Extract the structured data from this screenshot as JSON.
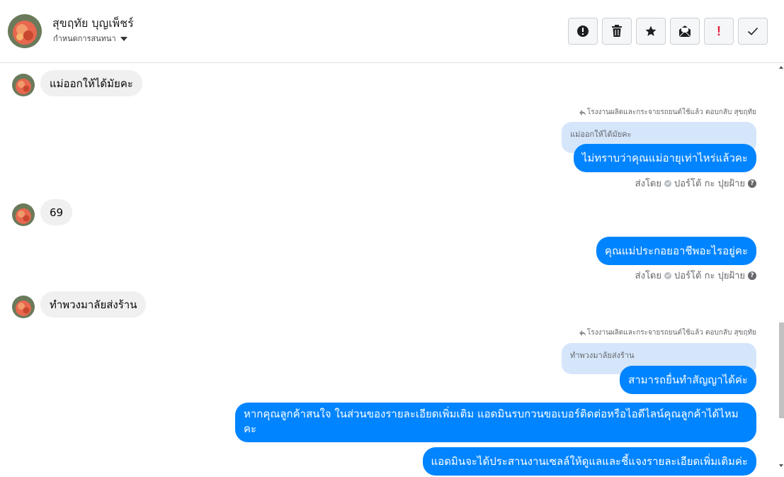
{
  "header": {
    "contact_name": "สุขฤทัย บุญเพ็ชร์",
    "subtitle": "กำหนดการสนทนา",
    "toolbar": {
      "report_icon": "alert-circle-icon",
      "delete_icon": "trash-icon",
      "star_icon": "star-icon",
      "mark_unread_icon": "open-envelope-icon",
      "important_label": "!",
      "done_icon": "checkmark-icon"
    }
  },
  "messages": {
    "m1": {
      "text": "แม่ออกให้ได้มัยคะ"
    },
    "m2": {
      "reply_note": "โรงงานผลิตและกระจายรถยนต์ใช้แล้ว ตอบกลับ สุขฤทัย",
      "quoted": "แม่ออกให้ได้มัยคะ",
      "text": "ไม่ทราบว่าคุณแม่อายุเท่าไหร่แล้วคะ",
      "sent_by": "ส่งโดย",
      "sender": "ปอร์โต้ กะ ปุยฝ้าย"
    },
    "m3": {
      "text": "69"
    },
    "m4": {
      "text": "คุณแม่ประกอยอาชีพอะไรอยู่คะ",
      "sent_by": "ส่งโดย",
      "sender": "ปอร์โต้ กะ ปุยฝ้าย"
    },
    "m5": {
      "text": "ทำพวงมาลัยส่งร้าน"
    },
    "m6": {
      "reply_note": "โรงงานผลิตและกระจายรถยนต์ใช้แล้ว ตอบกลับ สุขฤทัย",
      "quoted": "ทำพวงมาลัยส่งร้าน",
      "text": "สามารถยื่นทำสัญญาได้ค่ะ"
    },
    "m7": {
      "text": "หากคุณลูกค้าสนใจ ในส่วนของรายละเอียดเพิ่มเติม แอดมินรบกวนขอเบอร์ติดต่อหรือไอดีไลน์คุณลูกค้าได้ไหมคะ"
    },
    "m8": {
      "text": "แอดมินจะได้ประสานงานเซลล์ให้ดูแลและชี้แจงรายละเอียดเพิ่มเติมค่ะ"
    }
  },
  "colors": {
    "outgoing": "#0084ff",
    "incoming": "#f0f0f0",
    "quoted": "#d5e6fb",
    "important": "#e41e3f"
  }
}
